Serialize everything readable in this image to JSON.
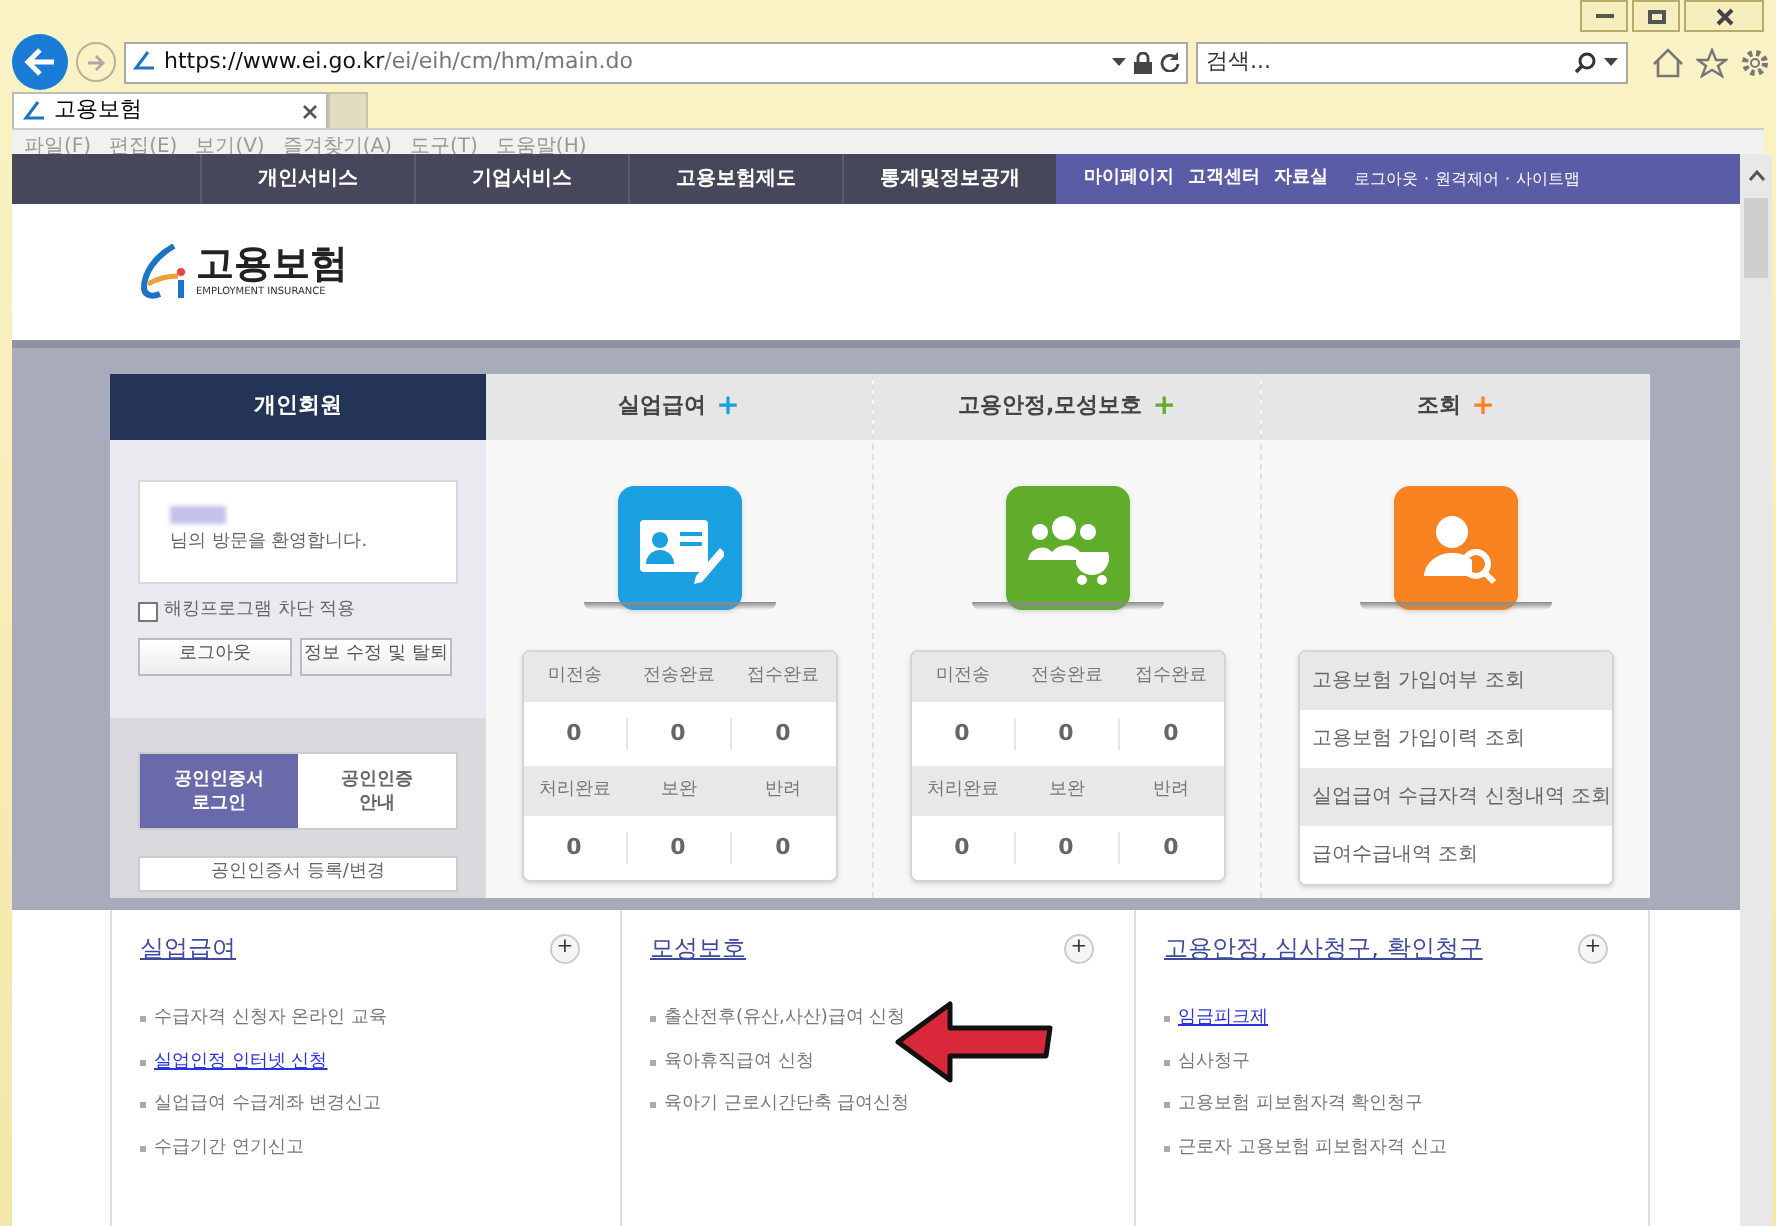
{
  "browser": {
    "address": {
      "host": "https://www.ei.go.kr",
      "path": "/ei/eih/cm/hm/main.do"
    },
    "search": {
      "placeholder": "검색..."
    },
    "tab": {
      "title": "고용보험"
    },
    "menu": [
      "파일(F)",
      "편집(E)",
      "보기(V)",
      "즐겨찾기(A)",
      "도구(T)",
      "도움말(H)"
    ]
  },
  "nav": {
    "items": [
      "개인서비스",
      "기업서비스",
      "고용보험제도",
      "통계및정보공개"
    ],
    "quick_links": [
      "마이페이지",
      "고객센터",
      "자료실"
    ],
    "utility_links": [
      "로그아웃",
      "원격제어",
      "사이트맵"
    ],
    "separator": "·"
  },
  "logo": {
    "title": "고용보험",
    "subtitle": "EMPLOYMENT INSURANCE"
  },
  "member_panel": {
    "title": "개인회원",
    "welcome": "님의 방문을 환영합니다.",
    "hacking_block": {
      "label": "해킹프로그램 차단 적용",
      "checked": false
    },
    "buttons": [
      "로그아웃",
      "정보 수정 및 탈퇴"
    ],
    "cert_tabs": [
      {
        "label": "공인인증서 로그인",
        "selected": true
      },
      {
        "label": "공인인증 안내",
        "selected": false
      }
    ],
    "cert_button": "공인인증서 등록/변경"
  },
  "services": [
    {
      "title": "실업급여",
      "plus": "+",
      "color": "#1ba1e2",
      "kind": "status",
      "status": [
        {
          "label": "미전송",
          "value": "0"
        },
        {
          "label": "전송완료",
          "value": "0"
        },
        {
          "label": "접수완료",
          "value": "0"
        },
        {
          "label": "처리완료",
          "value": "0"
        },
        {
          "label": "보완",
          "value": "0"
        },
        {
          "label": "반려",
          "value": "0"
        }
      ]
    },
    {
      "title": "고용안정,모성보호",
      "plus": "+",
      "color": "#5fad2b",
      "kind": "status",
      "status": [
        {
          "label": "미전송",
          "value": "0"
        },
        {
          "label": "전송완료",
          "value": "0"
        },
        {
          "label": "접수완료",
          "value": "0"
        },
        {
          "label": "처리완료",
          "value": "0"
        },
        {
          "label": "보완",
          "value": "0"
        },
        {
          "label": "반려",
          "value": "0"
        }
      ]
    },
    {
      "title": "조회",
      "plus": "+",
      "color": "#f7821f",
      "kind": "links",
      "links": [
        "고용보험 가입여부 조회",
        "고용보험 가입이력 조회",
        "실업급여 수급자격 신청내역 조회",
        "급여수급내역 조회"
      ]
    }
  ],
  "sections": [
    {
      "title": "실업급여",
      "plus": "+",
      "items": [
        {
          "text": "수급자격 신청자 온라인 교육",
          "highlighted": false
        },
        {
          "text": "실업인정 인터넷 신청",
          "highlighted": true
        },
        {
          "text": "실업급여 수급계좌 변경신고",
          "highlighted": false
        },
        {
          "text": "수급기간 연기신고",
          "highlighted": false
        }
      ]
    },
    {
      "title": "모성보호",
      "plus": "+",
      "items": [
        {
          "text": "출산전후(유산,사산)급여 신청",
          "highlighted": false
        },
        {
          "text": "육아휴직급여 신청",
          "highlighted": false
        },
        {
          "text": "육아기 근로시간단축 급여신청",
          "highlighted": false
        }
      ]
    },
    {
      "title": "고용안정, 심사청구, 확인청구",
      "plus": "+",
      "items": [
        {
          "text": "임금피크제",
          "highlighted": true
        },
        {
          "text": "심사청구",
          "highlighted": false
        },
        {
          "text": "고용보험 피보험자격 확인청구",
          "highlighted": false
        },
        {
          "text": "근로자 고용보험 피보험자격 신고",
          "highlighted": false
        }
      ]
    }
  ]
}
